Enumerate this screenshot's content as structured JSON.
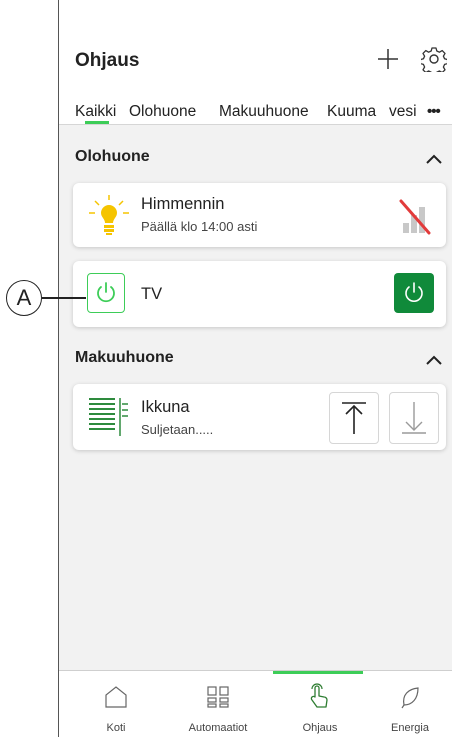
{
  "header": {
    "title": "Ohjaus",
    "add_icon": "plus-icon",
    "settings_icon": "gear-icon"
  },
  "tabs": [
    {
      "label": "Kaikki",
      "active": true
    },
    {
      "label": "Olohuone"
    },
    {
      "label": "Makuuhuone"
    },
    {
      "label": "Kuuma"
    },
    {
      "label": "vesi"
    }
  ],
  "more_label": "•••",
  "sections": {
    "olohuone": {
      "title": "Olohuone",
      "devices": {
        "dimmer": {
          "name": "Himmennin",
          "status": "Päällä klo 14:00 asti",
          "icon": "bulb-icon",
          "signal_icon": "no-signal-icon"
        },
        "tv": {
          "name": "TV",
          "icon": "power-icon",
          "power_on": true
        }
      }
    },
    "makuuhuone": {
      "title": "Makuuhuone",
      "devices": {
        "blind": {
          "name": "Ikkuna",
          "status": "Suljetaan.....",
          "icon": "blind-icon"
        }
      }
    }
  },
  "callout": {
    "label": "A"
  },
  "nav": [
    {
      "label": "Koti",
      "icon": "home-icon"
    },
    {
      "label": "Automaatiot",
      "icon": "grid-icon"
    },
    {
      "label": "Ohjaus",
      "icon": "hand-touch-icon",
      "active": true
    },
    {
      "label": "Energia",
      "icon": "leaf-icon"
    }
  ],
  "colors": {
    "accent": "#3dcd58",
    "power_button": "#108a3a",
    "bulb": "#f5c400",
    "no_signal_red": "#e23b3b"
  }
}
